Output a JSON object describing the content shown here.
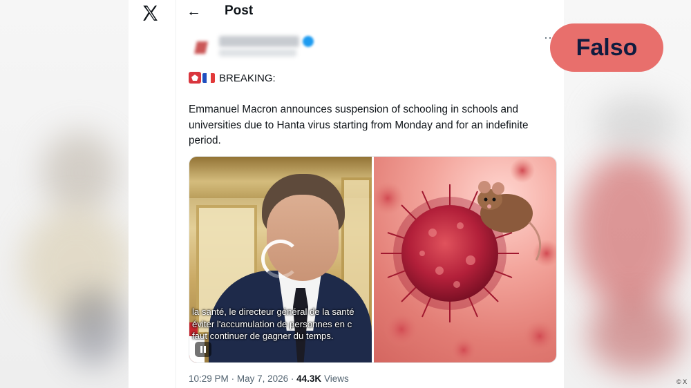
{
  "header": {
    "back_arrow": "←",
    "title": "Post"
  },
  "rail": {
    "logo": "x-logo-icon"
  },
  "post": {
    "breaking_label": "BREAKING:",
    "body": "Emmanuel Macron announces suspension of schooling in schools and universities due to Hanta virus starting from Monday and for an indefinite period.",
    "video_subtitles": [
      "la santé, le directeur général de la santé",
      "éviter l'accumulation de personnes en c",
      "faut continuer de gagner du temps."
    ],
    "time": "10:29 PM",
    "separator": "·",
    "date": "May 7, 2026",
    "views_count": "44.3K",
    "views_label": "Views"
  },
  "overlay": {
    "verdict": "Falso",
    "more_dots": "···",
    "credit": "© X"
  }
}
